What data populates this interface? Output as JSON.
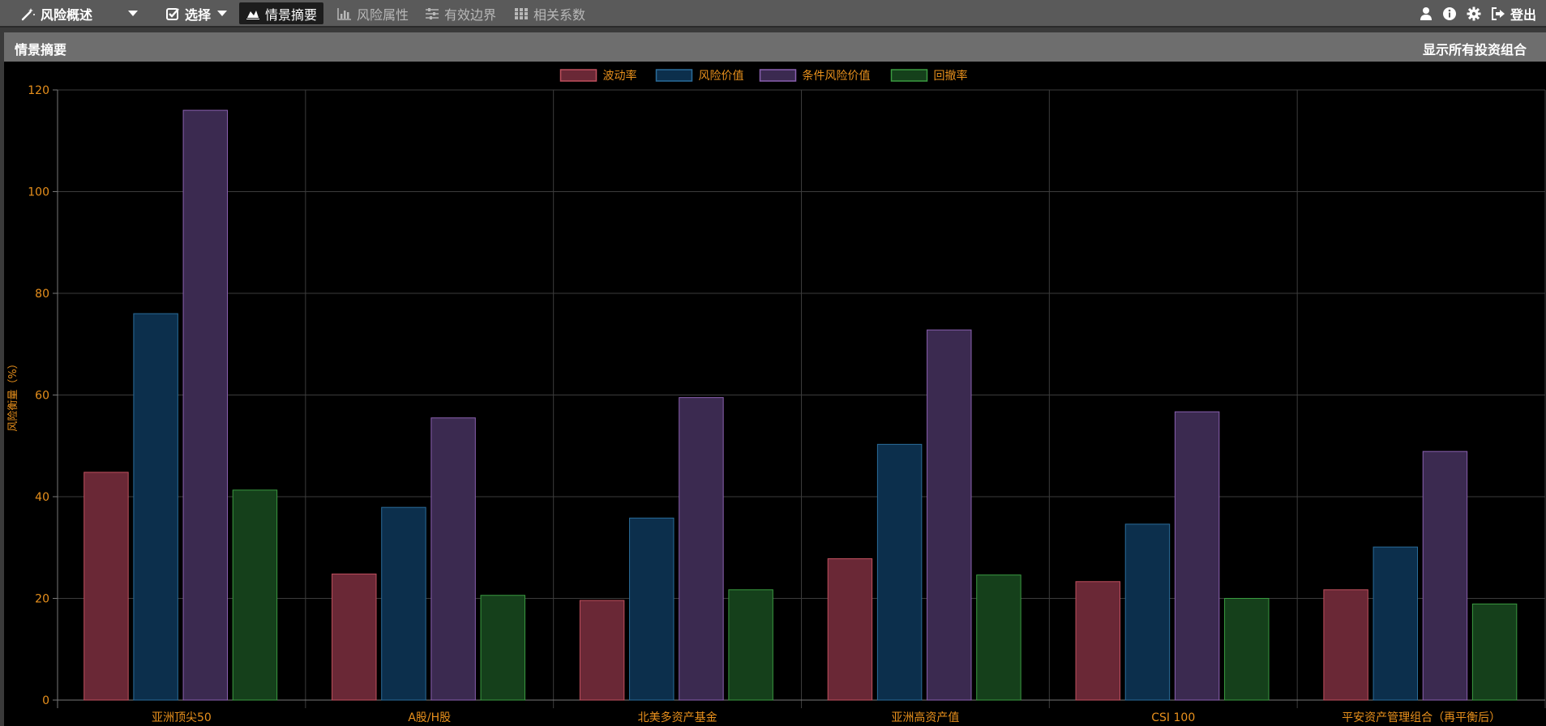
{
  "nav": {
    "brand_label": "风险概述",
    "select_label": "选择",
    "items": [
      {
        "label": "情景摘要",
        "active": true,
        "icon": "area-chart-icon"
      },
      {
        "label": "风险属性",
        "active": false,
        "icon": "bar-chart-icon"
      },
      {
        "label": "有效边界",
        "active": false,
        "icon": "sliders-icon"
      },
      {
        "label": "相关系数",
        "active": false,
        "icon": "grid-icon"
      }
    ],
    "right_icons": [
      "user-icon",
      "info-icon",
      "gear-icon",
      "logout-icon"
    ],
    "logout_label": "登出"
  },
  "panel": {
    "title": "情景摘要",
    "link_label": "显示所有投资组合"
  },
  "colors": {
    "tick_text": "#e8901c",
    "grid": "#3c3c3c",
    "series_fill": [
      "#6a2836",
      "#0c2f4c",
      "#3b2a50",
      "#15401b"
    ],
    "series_stroke": [
      "#c0505e",
      "#2a6c9a",
      "#8a60b0",
      "#3a9a40"
    ]
  },
  "chart_data": {
    "type": "bar",
    "ylabel": "风险衡量（%）",
    "ylim": [
      0,
      120
    ],
    "yticks": [
      0,
      20,
      40,
      60,
      80,
      100,
      120
    ],
    "grid": true,
    "legend_position": "top-center",
    "categories": [
      "亚洲顶尖50",
      "A股/H股",
      "北美多资产基金",
      "亚洲高资产值",
      "CSI 100",
      "平安资产管理组合（再平衡后）"
    ],
    "series": [
      {
        "name": "波动率",
        "values": [
          44.8,
          24.8,
          19.6,
          27.8,
          23.3,
          21.7
        ]
      },
      {
        "name": "风险价值",
        "values": [
          76.0,
          37.9,
          35.8,
          50.3,
          34.6,
          30.1
        ]
      },
      {
        "name": "条件风险价值",
        "values": [
          116.0,
          55.5,
          59.5,
          72.8,
          56.7,
          48.9
        ]
      },
      {
        "name": "回撤率",
        "values": [
          41.3,
          20.6,
          21.7,
          24.6,
          20.0,
          18.9
        ]
      }
    ]
  }
}
